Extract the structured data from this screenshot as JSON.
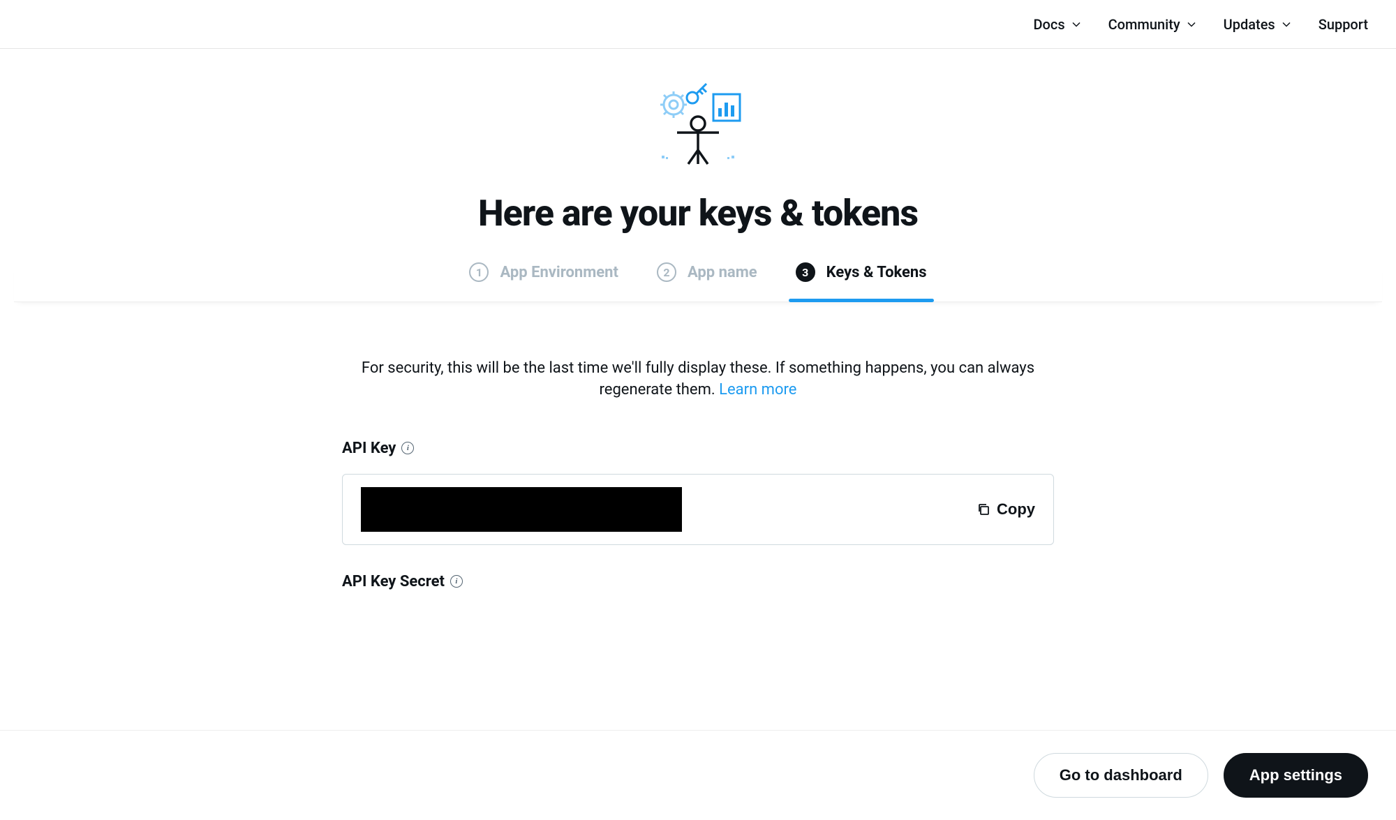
{
  "nav": {
    "docs": "Docs",
    "community": "Community",
    "updates": "Updates",
    "support": "Support"
  },
  "hero": {
    "title": "Here are your keys & tokens"
  },
  "stepper": {
    "step1": {
      "num": "1",
      "label": "App Environment"
    },
    "step2": {
      "num": "2",
      "label": "App name"
    },
    "step3": {
      "num": "3",
      "label": "Keys & Tokens"
    }
  },
  "content": {
    "security_text": "For security, this will be the last time we'll fully display these. If something happens, you can always regenerate them. ",
    "learn_more": "Learn more",
    "api_key_label": "API Key",
    "api_key_secret_label": "API Key Secret",
    "copy_label": "Copy"
  },
  "footer": {
    "dashboard_btn": "Go to dashboard",
    "settings_btn": "App settings"
  }
}
